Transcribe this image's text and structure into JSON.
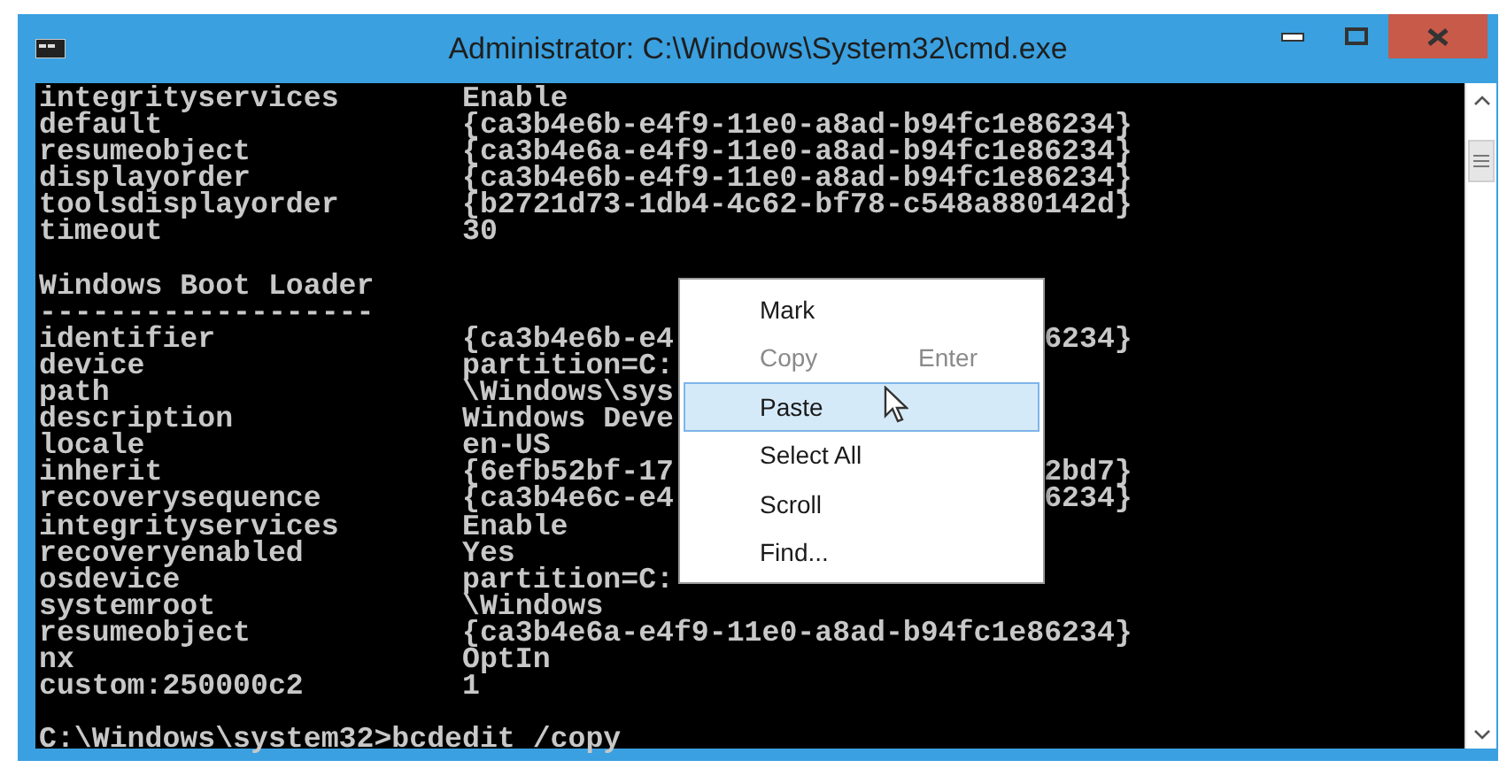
{
  "window": {
    "title": "Administrator: C:\\Windows\\System32\\cmd.exe"
  },
  "console": {
    "lines": [
      {
        "kind": "entry",
        "key": "integrityservices",
        "value": "Enable"
      },
      {
        "kind": "entry",
        "key": "default",
        "value": "{ca3b4e6b-e4f9-11e0-a8ad-b94fc1e86234}"
      },
      {
        "kind": "entry",
        "key": "resumeobject",
        "value": "{ca3b4e6a-e4f9-11e0-a8ad-b94fc1e86234}"
      },
      {
        "kind": "entry",
        "key": "displayorder",
        "value": "{ca3b4e6b-e4f9-11e0-a8ad-b94fc1e86234}"
      },
      {
        "kind": "entry",
        "key": "toolsdisplayorder",
        "value": "{b2721d73-1db4-4c62-bf78-c548a880142d}"
      },
      {
        "kind": "entry",
        "key": "timeout",
        "value": "30"
      },
      {
        "kind": "blank"
      },
      {
        "kind": "text",
        "key": "Windows Boot Loader"
      },
      {
        "kind": "text",
        "key": "-------------------"
      },
      {
        "kind": "entry",
        "key": "identifier",
        "value": "{ca3b4e6b-e4",
        "tail": "6234}"
      },
      {
        "kind": "entry",
        "key": "device",
        "value": "partition=C:"
      },
      {
        "kind": "entry",
        "key": "path",
        "value": "\\Windows\\sys"
      },
      {
        "kind": "entry",
        "key": "description",
        "value": "Windows Deve"
      },
      {
        "kind": "entry",
        "key": "locale",
        "value": "en-US"
      },
      {
        "kind": "entry",
        "key": "inherit",
        "value": "{6efb52bf-17",
        "tail": "2bd7}"
      },
      {
        "kind": "entry",
        "key": "recoverysequence",
        "value": "{ca3b4e6c-e4",
        "tail": "6234}"
      },
      {
        "kind": "entry",
        "key": "integrityservices",
        "value": "Enable"
      },
      {
        "kind": "entry",
        "key": "recoveryenabled",
        "value": "Yes"
      },
      {
        "kind": "entry",
        "key": "osdevice",
        "value": "partition=C:"
      },
      {
        "kind": "entry",
        "key": "systemroot",
        "value": "\\Windows"
      },
      {
        "kind": "entry",
        "key": "resumeobject",
        "value": "{ca3b4e6a-e4f9-11e0-a8ad-b94fc1e86234}"
      },
      {
        "kind": "entry",
        "key": "nx",
        "value": "OptIn"
      },
      {
        "kind": "entry",
        "key": "custom:250000c2",
        "value": "1"
      },
      {
        "kind": "blank"
      },
      {
        "kind": "text",
        "key": "C:\\Windows\\system32>bcdedit /copy"
      }
    ]
  },
  "context_menu": {
    "items": [
      {
        "label": "Mark",
        "disabled": false,
        "selected": false
      },
      {
        "label": "Copy",
        "shortcut": "Enter",
        "disabled": true,
        "selected": false
      },
      {
        "label": "Paste",
        "disabled": false,
        "selected": true
      },
      {
        "label": "Select All",
        "disabled": false,
        "selected": false
      },
      {
        "label": "Scroll",
        "disabled": false,
        "selected": false
      },
      {
        "label": "Find...",
        "disabled": false,
        "selected": false
      }
    ]
  }
}
